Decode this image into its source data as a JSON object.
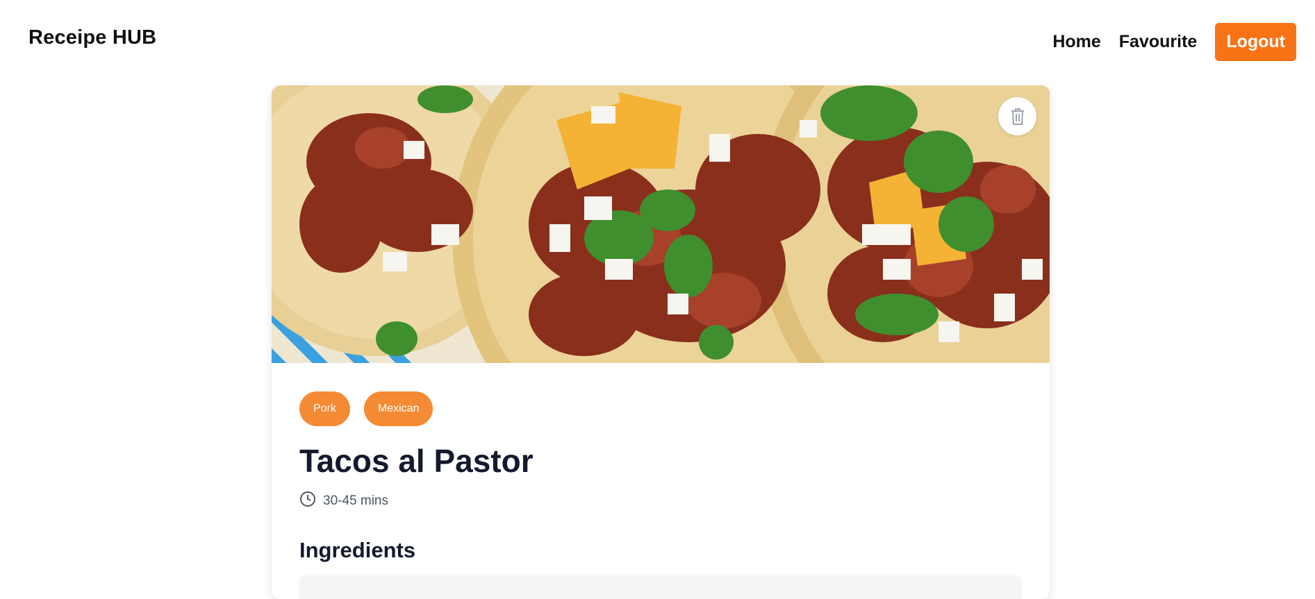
{
  "header": {
    "brand": "Receipe HUB",
    "nav": {
      "home": "Home",
      "favourite": "Favourite",
      "logout": "Logout"
    }
  },
  "recipe": {
    "tags": [
      "Pork",
      "Mexican"
    ],
    "title": "Tacos al Pastor",
    "time": "30-45 mins",
    "ingredients_heading": "Ingredients"
  },
  "icons": {
    "delete": "trash-icon",
    "time": "clock-icon"
  },
  "colors": {
    "accent": "#f97316",
    "tag": "#f58a34",
    "heading": "#141a2e"
  }
}
